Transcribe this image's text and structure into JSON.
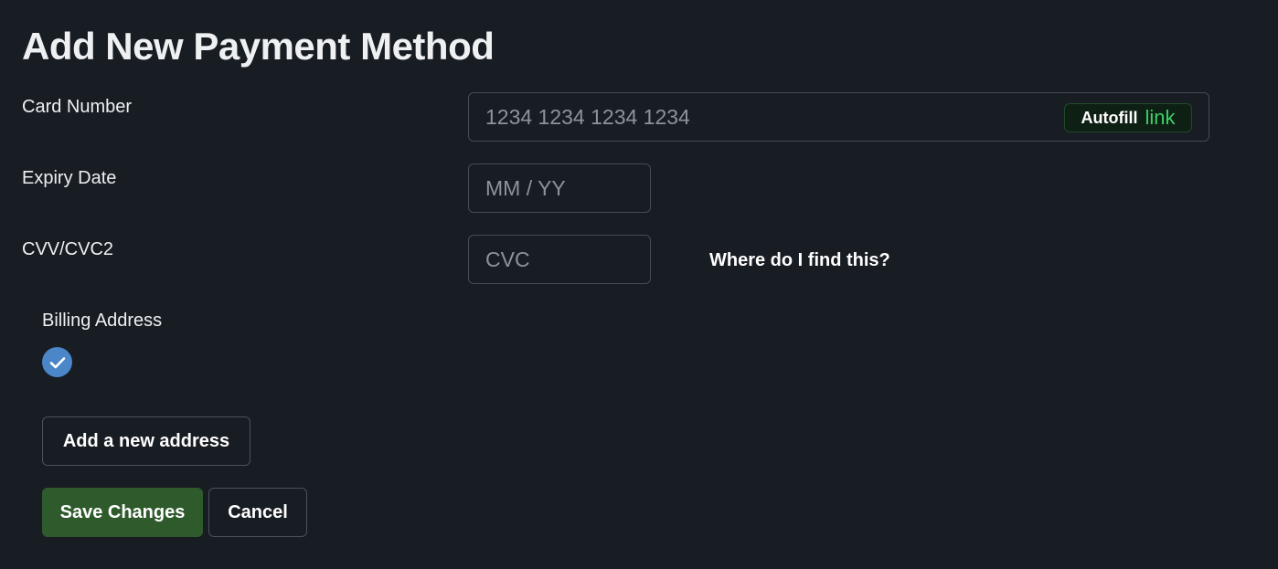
{
  "page": {
    "title": "Add New Payment Method"
  },
  "card_number": {
    "label": "Card Number",
    "placeholder": "1234 1234 1234 1234",
    "autofill_label": "Autofill",
    "autofill_brand": "link"
  },
  "expiry": {
    "label": "Expiry Date",
    "placeholder": "MM / YY"
  },
  "cvc": {
    "label": "CVV/CVC2",
    "placeholder": "CVC",
    "help_link": "Where do I find this?"
  },
  "billing": {
    "label": "Billing Address",
    "selected": true,
    "add_address_label": "Add a new address"
  },
  "actions": {
    "save_label": "Save Changes",
    "cancel_label": "Cancel"
  },
  "colors": {
    "background": "#181c23",
    "save_button": "#2e5a2c",
    "checkbox": "#4a86c8",
    "link_brand": "#3ecf6a"
  },
  "icons": {
    "check": "check-circle-icon"
  }
}
